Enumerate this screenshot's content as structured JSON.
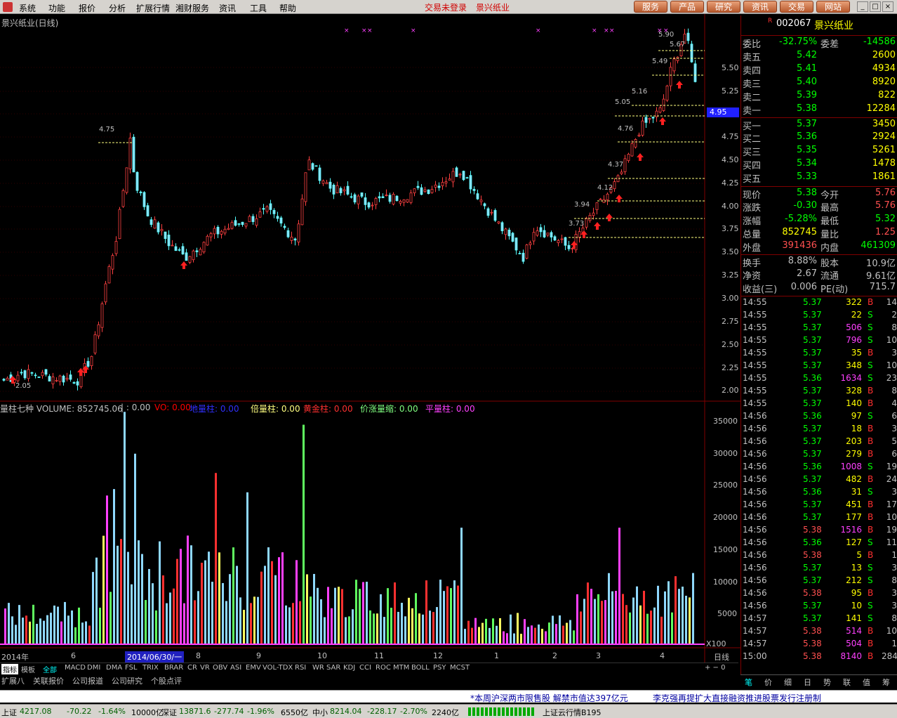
{
  "menubar": {
    "items": [
      "系统",
      "功能",
      "报价",
      "分析",
      "扩展行情",
      "湘财服务",
      "资讯",
      "工具",
      "帮助"
    ],
    "warning": "交易未登录",
    "stock_name": "景兴纸业",
    "buttons": [
      "服务",
      "产品",
      "研究",
      "资讯",
      "交易",
      "网站"
    ]
  },
  "chart": {
    "title": "景兴纸业(日线)",
    "current_price_badge": "4.95",
    "price_labels": [
      "5.50",
      "5.25",
      "5.00",
      "4.75",
      "4.50",
      "4.25",
      "4.00",
      "3.75",
      "3.50",
      "3.25",
      "3.00",
      "2.75",
      "2.50",
      "2.25",
      "2.00"
    ],
    "low_label": "2.05",
    "level_labels": [
      "5.90",
      "5.67",
      "5.49",
      "5.16",
      "5.05",
      "4.76",
      "4.75",
      "4.37",
      "4.12",
      "3.94",
      "3.73"
    ],
    "time_labels": [
      "2014年",
      "6",
      "8",
      "9",
      "10",
      "11",
      "12",
      "1",
      "2",
      "3",
      "4"
    ],
    "time_selected": "2014/06/30/一",
    "period_label": "日线"
  },
  "volume": {
    "title": "量柱七种 VOLUME: 852745.06",
    "indicators": [
      {
        "label": "VO: 0.00",
        "color": "#ff0000"
      },
      {
        "label": "地量柱: 0.00",
        "color": "#0000ff"
      },
      {
        "label": "倍量柱: 0.00",
        "color": "#ffff80"
      },
      {
        "label": "黄金柱: 0.00",
        "color": "#ff3030"
      },
      {
        "label": "价涨量缩: 0.00",
        "color": "#80ff80"
      },
      {
        "label": "平量柱: 0.00",
        "color": "#ff40ff"
      }
    ],
    "scale_labels": [
      "35000",
      "30000",
      "25000",
      "20000",
      "15000",
      "10000",
      "5000"
    ],
    "multiplier": "X100"
  },
  "indicator_tabs": [
    "指标",
    "模板",
    "全部",
    "MACD",
    "DMI",
    "DMA",
    "FSL",
    "TRIX",
    "BRAR",
    "CR",
    "VR",
    "OBV",
    "ASI",
    "EMV",
    "VOL-TDX",
    "RSI",
    "WR",
    "SAR",
    "KDJ",
    "CCI",
    "ROC",
    "MTM",
    "BOLL",
    "PSY",
    "MCST"
  ],
  "sub_tabs": [
    "扩展八",
    "关联报价",
    "公司报道",
    "公司研究",
    "个股点评"
  ],
  "news": [
    "*本周沪深两市限售股  解禁市值达397亿元",
    "李克强再提扩大直接融资推进股票发行注册制"
  ],
  "statusbar": {
    "sh_label": "上证",
    "sh_value": "4217.08",
    "sh_change": "-70.22",
    "sh_pct": "-1.64%",
    "sh_amount": "10000亿",
    "sz_label": "深证",
    "sz_value": "13871.6",
    "sz_change": "-277.74",
    "sz_pct": "-1.96%",
    "sz_amount": "6550亿",
    "zx_label": "中小",
    "zx_value": "8214.04",
    "zx_change": "-228.17",
    "zx_pct": "-2.70%",
    "zx_amount": "2240亿",
    "server": "上证云行情B195"
  },
  "quote": {
    "code": "002067",
    "name": "景兴纸业",
    "weibi_label": "委比",
    "weibi": "-32.75%",
    "weicha_label": "委差",
    "weicha": "-14586",
    "asks": [
      {
        "label": "卖五",
        "price": "5.42",
        "vol": "2600"
      },
      {
        "label": "卖四",
        "price": "5.41",
        "vol": "4934"
      },
      {
        "label": "卖三",
        "price": "5.40",
        "vol": "8920"
      },
      {
        "label": "卖二",
        "price": "5.39",
        "vol": "822"
      },
      {
        "label": "卖一",
        "price": "5.38",
        "vol": "12284"
      }
    ],
    "bids": [
      {
        "label": "买一",
        "price": "5.37",
        "vol": "3450"
      },
      {
        "label": "买二",
        "price": "5.36",
        "vol": "2924"
      },
      {
        "label": "买三",
        "price": "5.35",
        "vol": "5261"
      },
      {
        "label": "买四",
        "price": "5.34",
        "vol": "1478"
      },
      {
        "label": "买五",
        "price": "5.33",
        "vol": "1861"
      }
    ],
    "stats": [
      {
        "l1": "现价",
        "v1": "5.38",
        "c1": "#00ff00",
        "l2": "今开",
        "v2": "5.76",
        "c2": "#ff5050"
      },
      {
        "l1": "涨跌",
        "v1": "-0.30",
        "c1": "#00ff00",
        "l2": "最高",
        "v2": "5.76",
        "c2": "#ff5050"
      },
      {
        "l1": "涨幅",
        "v1": "-5.28%",
        "c1": "#00ff00",
        "l2": "最低",
        "v2": "5.32",
        "c2": "#00ff00"
      },
      {
        "l1": "总量",
        "v1": "852745",
        "c1": "#ffff00",
        "l2": "量比",
        "v2": "1.25",
        "c2": "#ff5050"
      },
      {
        "l1": "外盘",
        "v1": "391436",
        "c1": "#ff5050",
        "l2": "内盘",
        "v2": "461309",
        "c2": "#00ff00"
      }
    ],
    "stats2": [
      {
        "l1": "换手",
        "v1": "8.88%",
        "l2": "股本",
        "v2": "10.9亿"
      },
      {
        "l1": "净资",
        "v1": "2.67",
        "l2": "流通",
        "v2": "9.61亿"
      },
      {
        "l1": "收益(三)",
        "v1": "0.006",
        "l2": "PE(动)",
        "v2": "715.7"
      }
    ]
  },
  "ticks": [
    {
      "t": "14:55",
      "p": "5.37",
      "v": "322",
      "d": "B",
      "n": "14"
    },
    {
      "t": "14:55",
      "p": "5.37",
      "v": "22",
      "d": "S",
      "n": "2"
    },
    {
      "t": "14:55",
      "p": "5.37",
      "v": "506",
      "d": "S",
      "n": "8"
    },
    {
      "t": "14:55",
      "p": "5.37",
      "v": "796",
      "d": "S",
      "n": "10"
    },
    {
      "t": "14:55",
      "p": "5.37",
      "v": "35",
      "d": "B",
      "n": "3"
    },
    {
      "t": "14:55",
      "p": "5.37",
      "v": "348",
      "d": "S",
      "n": "10"
    },
    {
      "t": "14:55",
      "p": "5.36",
      "v": "1634",
      "d": "S",
      "n": "23"
    },
    {
      "t": "14:55",
      "p": "5.37",
      "v": "328",
      "d": "B",
      "n": "8"
    },
    {
      "t": "14:55",
      "p": "5.37",
      "v": "140",
      "d": "B",
      "n": "4"
    },
    {
      "t": "14:56",
      "p": "5.36",
      "v": "97",
      "d": "S",
      "n": "6"
    },
    {
      "t": "14:56",
      "p": "5.37",
      "v": "18",
      "d": "B",
      "n": "3"
    },
    {
      "t": "14:56",
      "p": "5.37",
      "v": "203",
      "d": "B",
      "n": "5"
    },
    {
      "t": "14:56",
      "p": "5.37",
      "v": "279",
      "d": "B",
      "n": "6"
    },
    {
      "t": "14:56",
      "p": "5.36",
      "v": "1008",
      "d": "S",
      "n": "19"
    },
    {
      "t": "14:56",
      "p": "5.37",
      "v": "482",
      "d": "B",
      "n": "24"
    },
    {
      "t": "14:56",
      "p": "5.36",
      "v": "31",
      "d": "S",
      "n": "3"
    },
    {
      "t": "14:56",
      "p": "5.37",
      "v": "451",
      "d": "B",
      "n": "17"
    },
    {
      "t": "14:56",
      "p": "5.37",
      "v": "177",
      "d": "B",
      "n": "10"
    },
    {
      "t": "14:56",
      "p": "5.38",
      "v": "1516",
      "d": "B",
      "n": "19"
    },
    {
      "t": "14:56",
      "p": "5.36",
      "v": "127",
      "d": "S",
      "n": "11"
    },
    {
      "t": "14:56",
      "p": "5.38",
      "v": "5",
      "d": "B",
      "n": "1"
    },
    {
      "t": "14:56",
      "p": "5.37",
      "v": "13",
      "d": "S",
      "n": "3"
    },
    {
      "t": "14:56",
      "p": "5.37",
      "v": "212",
      "d": "S",
      "n": "8"
    },
    {
      "t": "14:56",
      "p": "5.38",
      "v": "95",
      "d": "B",
      "n": "3"
    },
    {
      "t": "14:56",
      "p": "5.37",
      "v": "10",
      "d": "S",
      "n": "3"
    },
    {
      "t": "14:57",
      "p": "5.37",
      "v": "141",
      "d": "S",
      "n": "8"
    },
    {
      "t": "14:57",
      "p": "5.38",
      "v": "514",
      "d": "B",
      "n": "10"
    },
    {
      "t": "14:57",
      "p": "5.38",
      "v": "504",
      "d": "B",
      "n": "1"
    },
    {
      "t": "15:00",
      "p": "5.38",
      "v": "8140",
      "d": "B",
      "n": "284"
    }
  ],
  "rp_tabs": [
    "笔",
    "价",
    "细",
    "日",
    "势",
    "联",
    "值",
    "筹"
  ]
}
